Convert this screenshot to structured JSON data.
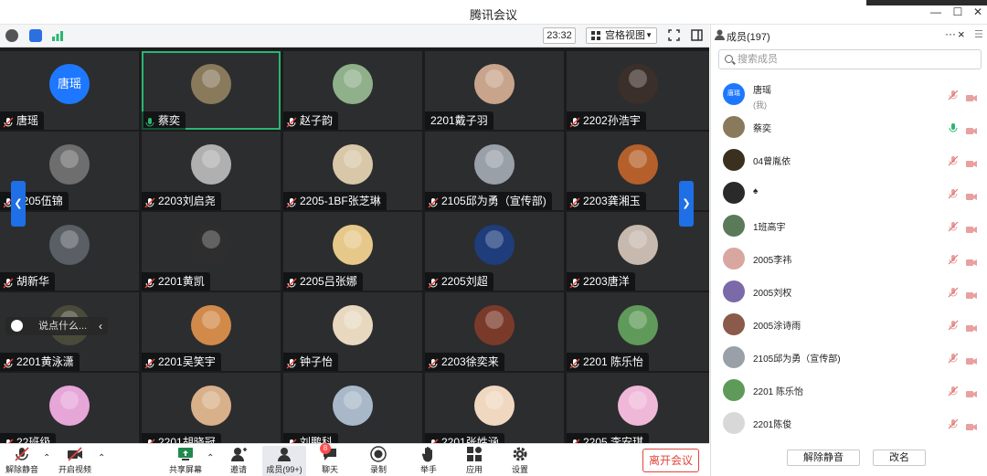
{
  "window": {
    "title": "腾讯会议"
  },
  "meeting_toolbar": {
    "timer": "23:32",
    "view_mode": "宫格视图"
  },
  "tiles": [
    {
      "name": "唐瑶",
      "avatar_text": "唐瑶",
      "avatar_color": "#1e78ff"
    },
    {
      "name": "蔡奕",
      "avatar_color": "#8a7a5c",
      "active": true,
      "speaking": true
    },
    {
      "name": "赵子韵",
      "avatar_color": "#8fb08a"
    },
    {
      "name": "2201戴子羽",
      "avatar_color": "#c9a48c",
      "no_mic": true
    },
    {
      "name": "2202孙浩宇",
      "avatar_color": "#3b2f2a"
    },
    {
      "name": "2205伍锦",
      "avatar_color": "#6e6e6e"
    },
    {
      "name": "2203刘启尧",
      "avatar_color": "#b0b0b0"
    },
    {
      "name": "2205-1BF张芝琳",
      "avatar_color": "#d8c7a8"
    },
    {
      "name": "2105邱为勇（宣传部)",
      "avatar_color": "#9aa0a8"
    },
    {
      "name": "2203龚湘玉",
      "avatar_color": "#b5602a"
    },
    {
      "name": "胡新华",
      "avatar_color": "#5a5f66"
    },
    {
      "name": "2201黄凯",
      "avatar_color": "#2e2e2e"
    },
    {
      "name": "2205吕张娜",
      "avatar_color": "#e6c98a"
    },
    {
      "name": "2205刘超",
      "avatar_color": "#1e3d7a"
    },
    {
      "name": "2203唐洋",
      "avatar_color": "#c7b9ad"
    },
    {
      "name": "2201黄泳潇",
      "avatar_color": "#4a4a3a"
    },
    {
      "name": "2201吴笑宇",
      "avatar_color": "#d28a4a"
    },
    {
      "name": "钟子怡",
      "avatar_color": "#e8d8c0"
    },
    {
      "name": "2203徐奕来",
      "avatar_color": "#7a3a2a"
    },
    {
      "name": "2201 陈乐怡",
      "avatar_color": "#5f9a5a"
    },
    {
      "name": "22班级",
      "avatar_color": "#e6a6d8"
    },
    {
      "name": "2201胡晓冠",
      "avatar_color": "#d8b08a"
    },
    {
      "name": "刘鹏科",
      "avatar_color": "#a8b8c8"
    },
    {
      "name": "2201张姓涵",
      "avatar_color": "#f0d8c0"
    },
    {
      "name": "2205 李安琪",
      "avatar_color": "#f0b8d8"
    }
  ],
  "chat_popup": {
    "placeholder": "说点什么..."
  },
  "bottom_toolbar": {
    "unmute": "解除静音",
    "start_video": "开启视频",
    "share_screen": "共享屏幕",
    "invite": "邀请",
    "members": "成员(99+)",
    "chat": "聊天",
    "chat_badge": "8",
    "record": "录制",
    "raise_hand": "举手",
    "apps": "应用",
    "settings": "设置",
    "leave": "离开会议"
  },
  "panel": {
    "title": "成员(197)",
    "more": "···",
    "close": "×",
    "search_placeholder": "搜索成员",
    "members": [
      {
        "name": "唐瑶",
        "sub": "(我)",
        "avatar_text": "唐瑶",
        "avatar_color": "#1e78ff"
      },
      {
        "name": "蔡奕",
        "avatar_color": "#8a7a5c",
        "mic_on": true
      },
      {
        "name": "04曾胤依",
        "avatar_color": "#3a3020"
      },
      {
        "name": "♠",
        "avatar_color": "#2a2a2a"
      },
      {
        "name": "1班高宇",
        "avatar_color": "#5a7a5a"
      },
      {
        "name": "2005李祎",
        "avatar_color": "#d8a8a0"
      },
      {
        "name": "2005刘权",
        "avatar_color": "#7a6aa8"
      },
      {
        "name": "2005涂诗雨",
        "avatar_color": "#8a5a4a"
      },
      {
        "name": "2105邱为勇（宣传部)",
        "avatar_color": "#9aa0a8"
      },
      {
        "name": "2201 陈乐怡",
        "avatar_color": "#5f9a5a"
      },
      {
        "name": "2201陈俊",
        "avatar_color": "#d8d8d8"
      }
    ],
    "unmute_all": "解除静音",
    "rename": "改名"
  },
  "colors": {
    "accent": "#1e78ff",
    "active_border": "#2bb673",
    "danger": "#e0443c",
    "muted_icon": "#e07a7a"
  }
}
